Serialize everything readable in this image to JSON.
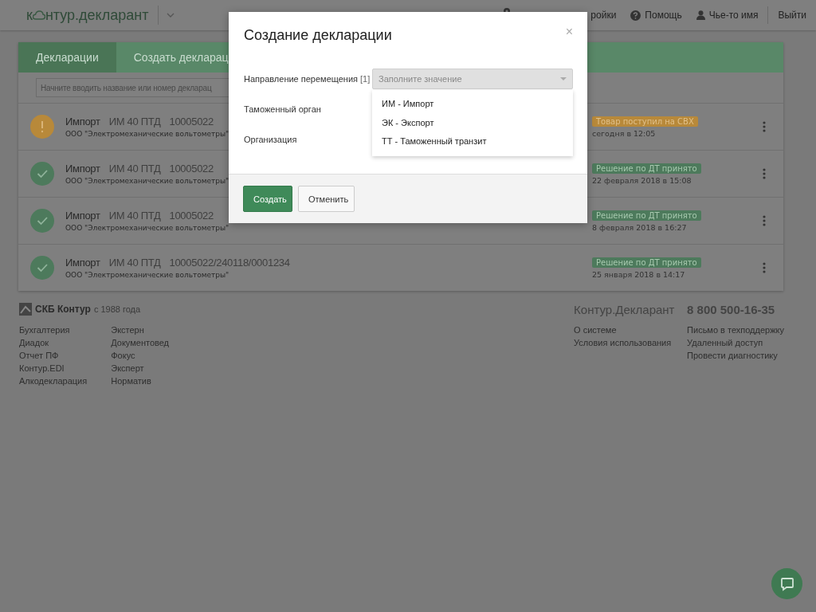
{
  "header": {
    "logo_start": "к",
    "logo_end": "нтур.декларант",
    "settings": "ройки",
    "help": "Помощь",
    "user": "Чье-то имя",
    "logout": "Выйти"
  },
  "tabs": [
    {
      "label": "Декларации",
      "selected": true
    },
    {
      "label": "Создать декларац",
      "selected": false
    }
  ],
  "search": {
    "placeholder": "Начните вводить название или номер декларац"
  },
  "rows": [
    {
      "kind": "warning",
      "type": "Импорт",
      "code": "ИМ 40 ПТД",
      "number": "10005022",
      "org": "ООО \"Электромеханические вольтометры\"",
      "badge": "Товар поступил на СВХ",
      "date": "сегодня в 12:05"
    },
    {
      "kind": "success",
      "type": "Импорт",
      "code": "ИМ 40 ПТД",
      "number": "10005022",
      "org": "ООО \"Электромеханические вольтометры\"",
      "badge": "Решение по ДТ принято",
      "date": "22 февраля 2018 в 15:08"
    },
    {
      "kind": "success",
      "type": "Импорт",
      "code": "ИМ 40 ПТД",
      "number": "10005022",
      "org": "ООО \"Электромеханические вольтометры\"",
      "badge": "Решение по ДТ принято",
      "date": "8 февраля 2018 в 16:27"
    },
    {
      "kind": "success",
      "type": "Импорт",
      "code": "ИМ 40 ПТД",
      "number": "10005022/240118/0001234",
      "org": "ООО \"Электромеханические вольтометры\"",
      "badge": "Решение по ДТ принято",
      "date": "25 января 2018 в 14:17"
    }
  ],
  "footer": {
    "brand": "СКБ Контур",
    "since": "с 1988 года",
    "col1": [
      "Бухгалтерия",
      "Диадок",
      "Отчет ПФ",
      "Контур.EDI",
      "Алкодекларация"
    ],
    "col2": [
      "Экстерн",
      "Документовед",
      "Фокус",
      "Эксперт",
      "Норматив"
    ],
    "product": "Контур.Декларант",
    "col3": [
      "О системе",
      "Условия использования"
    ],
    "phone": "8 800 500-16-35",
    "col4": [
      "Письмо в техподдержку",
      "Удаленный доступ",
      "Провести диагностику"
    ]
  },
  "modal": {
    "title": "Создание декларации",
    "close": "×",
    "fields": [
      {
        "label": "Направление перемещения",
        "hint": "[1]",
        "placeholder": "Заполните значение",
        "expanded": true
      },
      {
        "label": "Таможенный орган"
      },
      {
        "label": "Организация"
      }
    ],
    "options": [
      "ИМ - Импорт",
      "ЭК - Экспорт",
      "ТТ - Таможенный транзит"
    ],
    "create": "Создать",
    "cancel": "Отменить"
  }
}
